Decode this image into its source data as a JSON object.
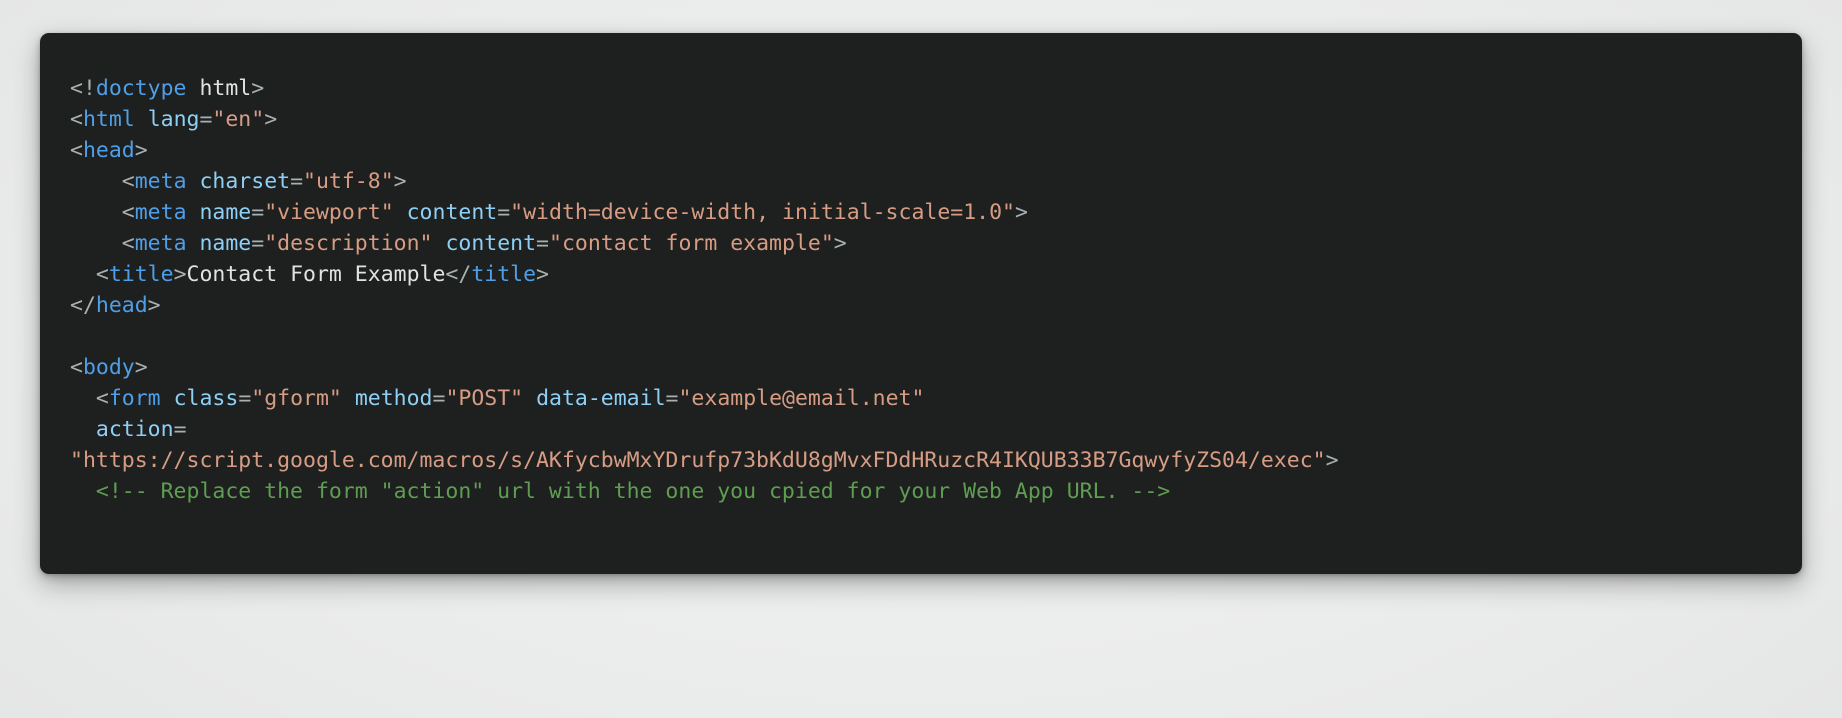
{
  "window": {
    "background_color": "#eceded",
    "card_background_color": "#1e1f1f",
    "card_corner_radius": "9px"
  },
  "theme": {
    "name": "dark-code-theme",
    "punctuation_color": "#a8b0b0",
    "tag_color": "#4f9fe8",
    "attribute_color": "#8ed0f5",
    "value_color": "#d79d84",
    "text_color": "#e2e2e2",
    "comment_color": "#5f9e52"
  },
  "code": {
    "language": "html",
    "lines": [
      {
        "n": 1,
        "indent": "",
        "tokens": [
          {
            "t": "punc",
            "s": "<!"
          },
          {
            "t": "tag",
            "s": "doctype"
          },
          {
            "t": "text",
            "s": " "
          },
          {
            "t": "text",
            "s": "html"
          },
          {
            "t": "punc",
            "s": ">"
          }
        ]
      },
      {
        "n": 2,
        "indent": "",
        "tokens": [
          {
            "t": "punc",
            "s": "<"
          },
          {
            "t": "tag",
            "s": "html"
          },
          {
            "t": "text",
            "s": " "
          },
          {
            "t": "attr",
            "s": "lang"
          },
          {
            "t": "punc",
            "s": "="
          },
          {
            "t": "val",
            "s": "\"en\""
          },
          {
            "t": "punc",
            "s": ">"
          }
        ]
      },
      {
        "n": 3,
        "indent": "",
        "tokens": [
          {
            "t": "punc",
            "s": "<"
          },
          {
            "t": "tag",
            "s": "head"
          },
          {
            "t": "punc",
            "s": ">"
          }
        ]
      },
      {
        "n": 4,
        "indent": "    ",
        "tokens": [
          {
            "t": "punc",
            "s": "<"
          },
          {
            "t": "tag",
            "s": "meta"
          },
          {
            "t": "text",
            "s": " "
          },
          {
            "t": "attr",
            "s": "charset"
          },
          {
            "t": "punc",
            "s": "="
          },
          {
            "t": "val",
            "s": "\"utf-8\""
          },
          {
            "t": "punc",
            "s": ">"
          }
        ]
      },
      {
        "n": 5,
        "indent": "    ",
        "tokens": [
          {
            "t": "punc",
            "s": "<"
          },
          {
            "t": "tag",
            "s": "meta"
          },
          {
            "t": "text",
            "s": " "
          },
          {
            "t": "attr",
            "s": "name"
          },
          {
            "t": "punc",
            "s": "="
          },
          {
            "t": "val",
            "s": "\"viewport\""
          },
          {
            "t": "text",
            "s": " "
          },
          {
            "t": "attr",
            "s": "content"
          },
          {
            "t": "punc",
            "s": "="
          },
          {
            "t": "val",
            "s": "\"width=device-width, initial-scale=1.0\""
          },
          {
            "t": "punc",
            "s": ">"
          }
        ]
      },
      {
        "n": 6,
        "indent": "    ",
        "tokens": [
          {
            "t": "punc",
            "s": "<"
          },
          {
            "t": "tag",
            "s": "meta"
          },
          {
            "t": "text",
            "s": " "
          },
          {
            "t": "attr",
            "s": "name"
          },
          {
            "t": "punc",
            "s": "="
          },
          {
            "t": "val",
            "s": "\"description\""
          },
          {
            "t": "text",
            "s": " "
          },
          {
            "t": "attr",
            "s": "content"
          },
          {
            "t": "punc",
            "s": "="
          },
          {
            "t": "val",
            "s": "\"contact form example\""
          },
          {
            "t": "punc",
            "s": ">"
          }
        ]
      },
      {
        "n": 7,
        "indent": "  ",
        "tokens": [
          {
            "t": "punc",
            "s": "<"
          },
          {
            "t": "tag",
            "s": "title"
          },
          {
            "t": "punc",
            "s": ">"
          },
          {
            "t": "text",
            "s": "Contact Form Example"
          },
          {
            "t": "punc",
            "s": "</"
          },
          {
            "t": "tag",
            "s": "title"
          },
          {
            "t": "punc",
            "s": ">"
          }
        ]
      },
      {
        "n": 8,
        "indent": "",
        "tokens": [
          {
            "t": "punc",
            "s": "</"
          },
          {
            "t": "tag",
            "s": "head"
          },
          {
            "t": "punc",
            "s": ">"
          }
        ]
      },
      {
        "n": 9,
        "indent": "",
        "tokens": []
      },
      {
        "n": 10,
        "indent": "",
        "tokens": [
          {
            "t": "punc",
            "s": "<"
          },
          {
            "t": "tag",
            "s": "body"
          },
          {
            "t": "punc",
            "s": ">"
          }
        ]
      },
      {
        "n": 11,
        "indent": "  ",
        "tokens": [
          {
            "t": "punc",
            "s": "<"
          },
          {
            "t": "tag",
            "s": "form"
          },
          {
            "t": "text",
            "s": " "
          },
          {
            "t": "attr",
            "s": "class"
          },
          {
            "t": "punc",
            "s": "="
          },
          {
            "t": "val",
            "s": "\"gform\""
          },
          {
            "t": "text",
            "s": " "
          },
          {
            "t": "attr",
            "s": "method"
          },
          {
            "t": "punc",
            "s": "="
          },
          {
            "t": "val",
            "s": "\"POST\""
          },
          {
            "t": "text",
            "s": " "
          },
          {
            "t": "attr",
            "s": "data-email"
          },
          {
            "t": "punc",
            "s": "="
          },
          {
            "t": "val",
            "s": "\"example@email.net\""
          }
        ]
      },
      {
        "n": 12,
        "indent": "  ",
        "tokens": [
          {
            "t": "attr",
            "s": "action"
          },
          {
            "t": "punc",
            "s": "="
          }
        ]
      },
      {
        "n": 13,
        "indent": "",
        "tokens": [
          {
            "t": "val",
            "s": "\"https://script.google.com/macros/s/AKfycbwMxYDrufp73bKdU8gMvxFDdHRuzcR4IKQUB33B7GqwyfyZS04/exec\""
          },
          {
            "t": "punc",
            "s": ">"
          }
        ]
      },
      {
        "n": 14,
        "indent": "  ",
        "tokens": [
          {
            "t": "cmt",
            "s": "<!-- Replace the form \"action\" url with the one you cpied for your Web App URL. -->"
          }
        ]
      }
    ]
  }
}
